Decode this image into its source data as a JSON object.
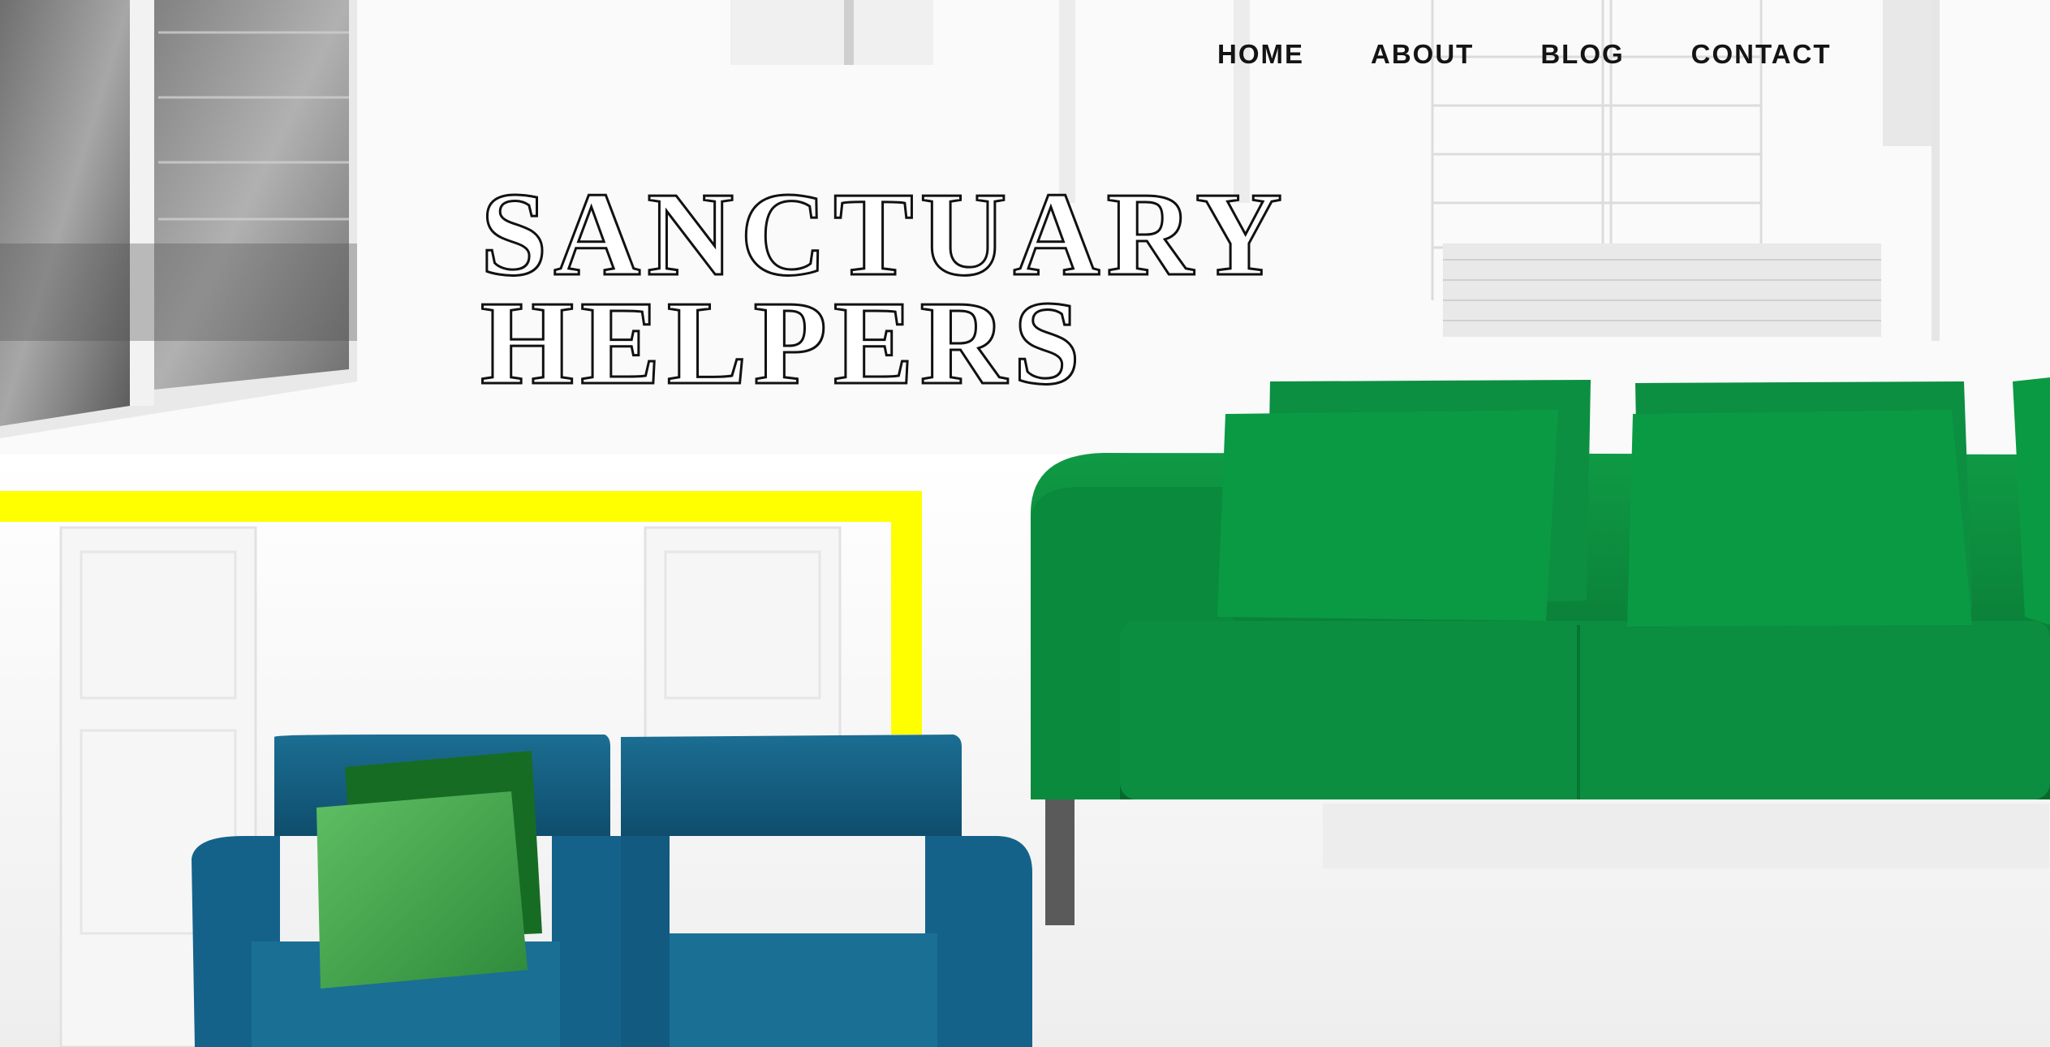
{
  "nav": {
    "items": [
      {
        "label": "HOME"
      },
      {
        "label": "ABOUT"
      },
      {
        "label": "BLOG"
      },
      {
        "label": "CONTACT"
      }
    ]
  },
  "hero": {
    "title_line1": "SANCTUARY",
    "title_line2": "HELPERS"
  },
  "colors": {
    "accent_yellow": "#ffff00",
    "sofa_green": "#0a8a3c",
    "chair_blue": "#13597d",
    "nav_text": "#141414"
  },
  "icons": []
}
